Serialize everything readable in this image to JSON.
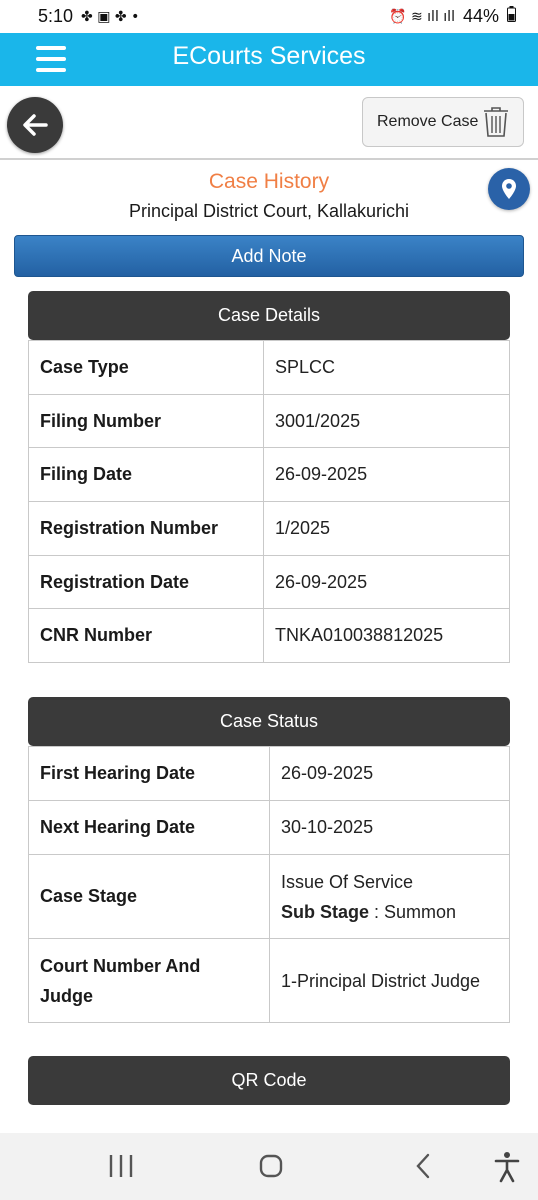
{
  "status_bar": {
    "time": "5:10",
    "battery": "44%"
  },
  "app_bar": {
    "title": "ECourts Services"
  },
  "toolbar": {
    "remove_label": "Remove Case"
  },
  "case": {
    "heading": "Case History",
    "court": "Principal District Court, Kallakurichi",
    "add_note_label": "Add Note"
  },
  "case_details": {
    "header": "Case Details",
    "rows": [
      {
        "label": "Case Type",
        "value": "SPLCC"
      },
      {
        "label": "Filing Number",
        "value": "3001/2025"
      },
      {
        "label": "Filing Date",
        "value": "26-09-2025"
      },
      {
        "label": "Registration Number",
        "value": "1/2025"
      },
      {
        "label": "Registration Date",
        "value": "26-09-2025"
      },
      {
        "label": "CNR Number",
        "value": "TNKA010038812025"
      }
    ]
  },
  "case_status": {
    "header": "Case Status",
    "first_hearing_label": "First Hearing Date",
    "first_hearing_value": "26-09-2025",
    "next_hearing_label": "Next Hearing Date",
    "next_hearing_value": "30-10-2025",
    "stage_label": "Case Stage",
    "stage_value": "Issue Of Service",
    "sub_stage_label": "Sub Stage",
    "sub_stage_separator": " : ",
    "sub_stage_value": "Summon",
    "court_judge_label": "Court Number And Judge",
    "court_judge_value": "1-Principal District Judge"
  },
  "qr": {
    "header": "QR Code"
  },
  "icons": {
    "menu": "hamburger-menu-icon",
    "back": "arrow-left-icon",
    "trash": "trash-icon",
    "location": "map-pin-icon",
    "nav_recents": "recents-icon",
    "nav_home": "home-icon",
    "nav_back": "back-chevron-icon",
    "nav_accessibility": "accessibility-icon"
  },
  "colors": {
    "app_bar": "#1ab6ea",
    "heading": "#f07f45",
    "add_note": "#2f72b8",
    "section_header": "#3a3a3a",
    "location_btn": "#2a62a8"
  }
}
